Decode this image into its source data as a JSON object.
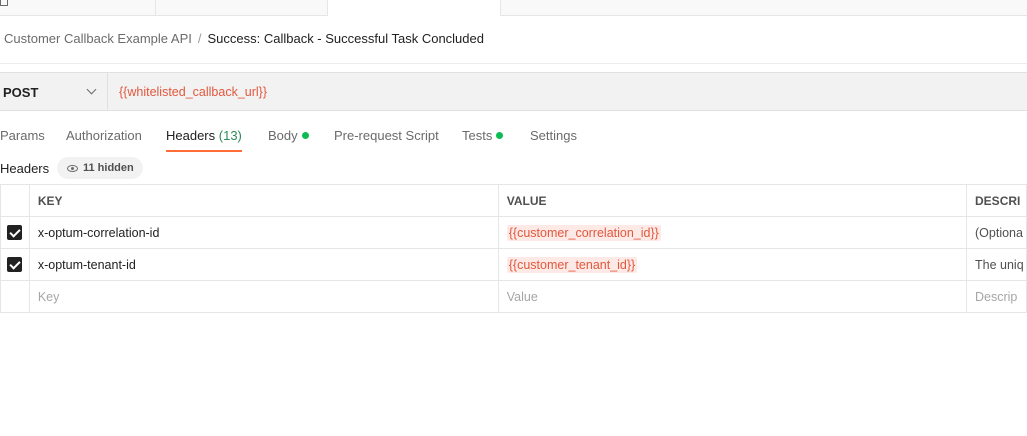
{
  "breadcrumb": {
    "parent": "Customer Callback Example API",
    "separator": "/",
    "current": "Success: Callback - Successful Task Concluded"
  },
  "request": {
    "method": "POST",
    "url": "{{whitelisted_callback_url}}"
  },
  "subtabs": [
    {
      "label": "Params"
    },
    {
      "label": "Authorization"
    },
    {
      "label": "Headers",
      "count": "(13)"
    },
    {
      "label": "Body"
    },
    {
      "label": "Pre-request Script"
    },
    {
      "label": "Tests"
    },
    {
      "label": "Settings"
    }
  ],
  "headers_section": {
    "label": "Headers",
    "hidden_badge": "11 hidden"
  },
  "table": {
    "columns": [
      "KEY",
      "VALUE",
      "DESCRI"
    ],
    "rows": [
      {
        "key": "x-optum-correlation-id",
        "value": "{{customer_correlation_id}}",
        "description": "(Optiona"
      },
      {
        "key": "x-optum-tenant-id",
        "value": "{{customer_tenant_id}}",
        "description": "The uniq"
      }
    ],
    "placeholder": {
      "key": "Key",
      "value": "Value",
      "description": "Descrip"
    }
  },
  "colors": {
    "accent": "#ff6c37",
    "variable": "#e2583e",
    "status_dot": "#0cbb52"
  }
}
